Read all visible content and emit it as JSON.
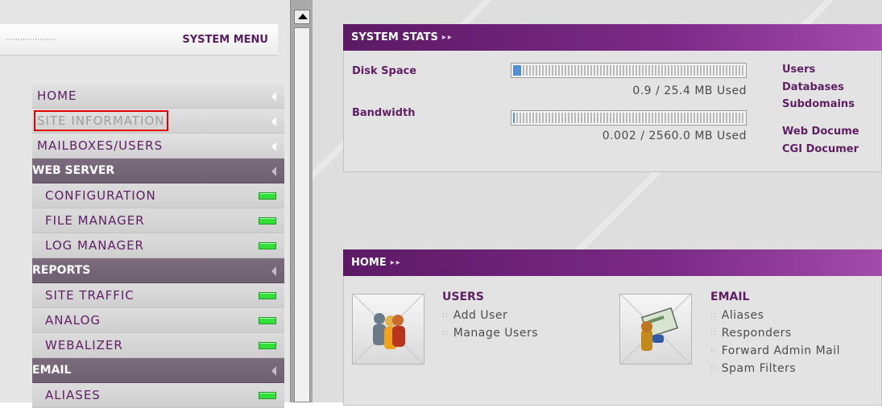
{
  "sidebar": {
    "title": "SYSTEM MENU",
    "items": [
      {
        "label": "HOME",
        "type": "top",
        "indicator": "arrow"
      },
      {
        "label": "SITE INFORMATION",
        "type": "top",
        "indicator": "arrow",
        "highlighted": true
      },
      {
        "label": "MAILBOXES/USERS",
        "type": "top",
        "indicator": "arrow"
      },
      {
        "label": "WEB SERVER",
        "type": "section",
        "indicator": "arrow"
      },
      {
        "label": "CONFIGURATION",
        "type": "sub",
        "indicator": "status"
      },
      {
        "label": "FILE MANAGER",
        "type": "sub",
        "indicator": "status"
      },
      {
        "label": "LOG MANAGER",
        "type": "sub",
        "indicator": "status"
      },
      {
        "label": "REPORTS",
        "type": "section",
        "indicator": "arrow"
      },
      {
        "label": "SITE TRAFFIC",
        "type": "sub",
        "indicator": "status"
      },
      {
        "label": "ANALOG",
        "type": "sub",
        "indicator": "status"
      },
      {
        "label": "WEBALIZER",
        "type": "sub",
        "indicator": "status"
      },
      {
        "label": "EMAIL",
        "type": "section",
        "indicator": "arrow"
      },
      {
        "label": "ALIASES",
        "type": "sub",
        "indicator": "status"
      }
    ]
  },
  "stats": {
    "title": "SYSTEM STATS",
    "title_suffix": "▸▸",
    "disk_label": "Disk Space",
    "disk_usage": "0.9 / 25.4 MB Used",
    "disk_fraction": 0.035,
    "bandwidth_label": "Bandwidth",
    "bandwidth_usage": "0.002 / 2560.0 MB Used",
    "bandwidth_fraction": 0.0,
    "links": [
      "Users",
      "Databases",
      "Subdomains",
      "Web Docume",
      "CGI Documer"
    ]
  },
  "home": {
    "title": "HOME",
    "title_suffix": "▸▸",
    "users_heading": "USERS",
    "users_items": [
      "Add User",
      "Manage Users"
    ],
    "email_heading": "EMAIL",
    "email_items": [
      "Aliases",
      "Responders",
      "Forward Admin Mail",
      "Spam Filters"
    ]
  },
  "colors": {
    "accent": "#5e1f63",
    "header_gradient_start": "#5c1a64",
    "status_green": "#33e03a",
    "highlight_border": "#e00000"
  }
}
